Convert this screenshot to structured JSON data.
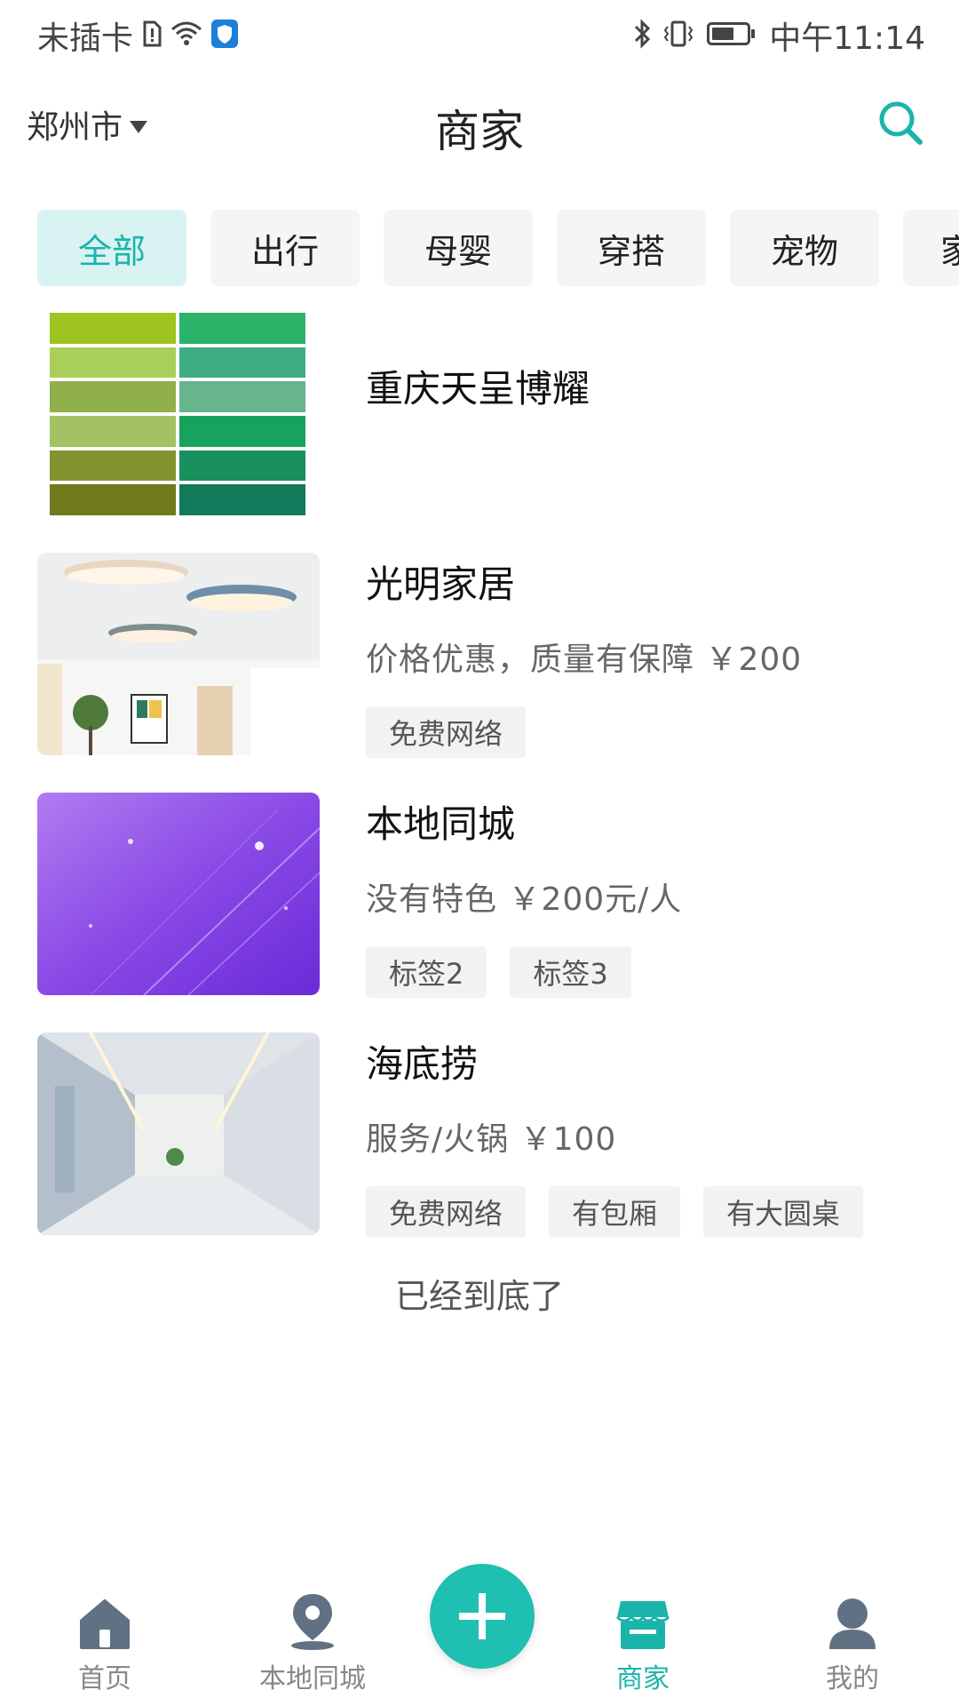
{
  "status_bar": {
    "carrier": "未插卡",
    "time": "中午11:14"
  },
  "header": {
    "city": "郑州市",
    "title": "商家"
  },
  "tabs": [
    {
      "label": "全部",
      "active": true
    },
    {
      "label": "出行",
      "active": false
    },
    {
      "label": "母婴",
      "active": false
    },
    {
      "label": "穿搭",
      "active": false
    },
    {
      "label": "宠物",
      "active": false
    },
    {
      "label": "家",
      "active": false
    }
  ],
  "merchants": [
    {
      "name": "重庆天呈博耀",
      "desc": "",
      "tags": [],
      "image": "green-color-palette"
    },
    {
      "name": "光明家居",
      "desc": "价格优惠，质量有保障 ￥200",
      "tags": [
        "免费网络"
      ],
      "image": "ceiling-lamps-room"
    },
    {
      "name": "本地同城",
      "desc": "没有特色 ￥200元/人",
      "tags": [
        "标签2",
        "标签3"
      ],
      "image": "purple-gradient"
    },
    {
      "name": "海底捞",
      "desc": "服务/火锅 ￥100",
      "tags": [
        "免费网络",
        "有包厢",
        "有大圆桌"
      ],
      "image": "corridor-interior"
    }
  ],
  "list_end_text": "已经到底了",
  "bottom_nav": [
    {
      "label": "首页",
      "icon": "home-icon",
      "active": false
    },
    {
      "label": "本地同城",
      "icon": "location-pin-icon",
      "active": false
    },
    {
      "label": "",
      "icon": "plus-icon",
      "active": false
    },
    {
      "label": "商家",
      "icon": "store-icon",
      "active": true
    },
    {
      "label": "我的",
      "icon": "user-icon",
      "active": false
    }
  ],
  "colors": {
    "accent": "#1bb4ab",
    "tab_active_bg": "#d9f3f2",
    "tab_bg": "#f5f5f5",
    "tag_bg": "#f2f2f2"
  }
}
